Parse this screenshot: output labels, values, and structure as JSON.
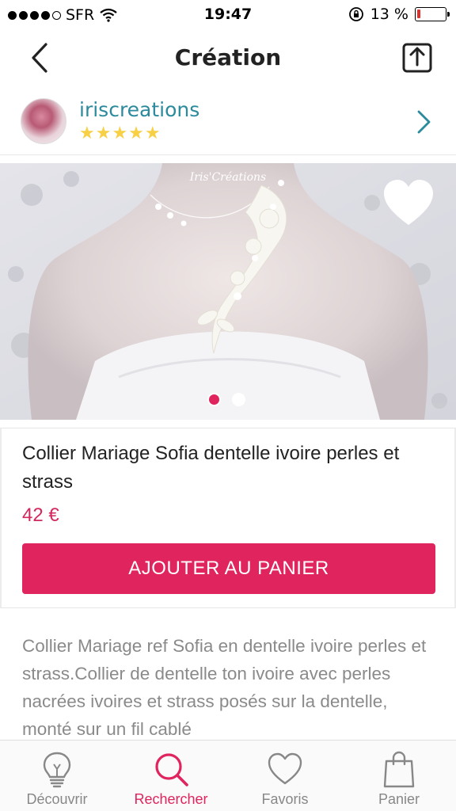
{
  "status_bar": {
    "carrier": "SFR",
    "time": "19:47",
    "battery_percent": "13 %",
    "battery_level": 0.13
  },
  "nav": {
    "title": "Création",
    "back_icon": "chevron-left-icon",
    "share_icon": "share-icon"
  },
  "seller": {
    "name": "iriscreations",
    "rating_stars": "★★★★★",
    "rating": 5
  },
  "product_image": {
    "watermark": "Iris'Créations",
    "favorite_icon": "heart-icon",
    "page_count": 2,
    "active_page": 0
  },
  "product": {
    "title": "Collier Mariage Sofia dentelle ivoire perles et strass",
    "price": "42 €",
    "add_to_cart_label": "AJOUTER AU PANIER"
  },
  "description": "Collier Mariage ref Sofia en dentelle ivoire perles et strass.Collier de dentelle ton ivoire avec perles nacrées ivoires et strass posés sur la dentelle, monté sur un fil cablé",
  "tabs": [
    {
      "label": "Découvrir",
      "icon": "lightbulb-icon",
      "active": false
    },
    {
      "label": "Rechercher",
      "icon": "search-icon",
      "active": true
    },
    {
      "label": "Favoris",
      "icon": "heart-outline-icon",
      "active": false
    },
    {
      "label": "Panier",
      "icon": "shopping-bag-icon",
      "active": false
    }
  ],
  "colors": {
    "accent": "#e0245e",
    "seller_link": "#2b8a9b",
    "stars": "#f7d046",
    "description_text": "#8a8a8a"
  }
}
